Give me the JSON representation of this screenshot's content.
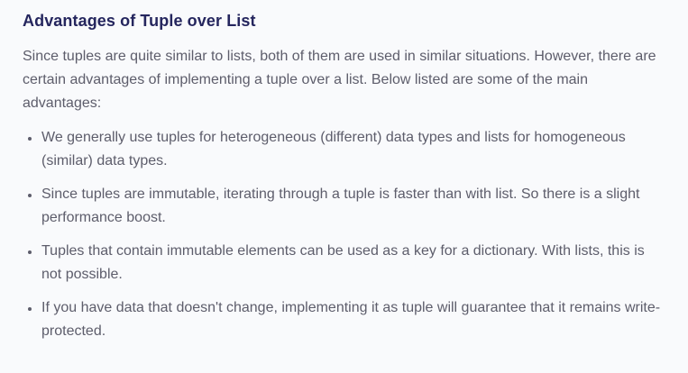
{
  "article": {
    "heading": "Advantages of Tuple over List",
    "intro": "Since tuples are quite similar to lists, both of them are used in similar situations. However, there are certain advantages of implementing a tuple over a list. Below listed are some of the main advantages:",
    "advantages": [
      "We generally use tuples for heterogeneous (different) data types and lists for homogeneous (similar) data types.",
      "Since tuples are immutable, iterating through a tuple is faster than with list. So there is a slight performance boost.",
      "Tuples that contain immutable elements can be used as a key for a dictionary. With lists, this is not possible.",
      "If you have data that doesn't change, implementing it as tuple will guarantee that it remains write-protected."
    ]
  },
  "colors": {
    "heading": "#25265e",
    "body_text": "#5d5d6b",
    "background": "#f9fafc"
  }
}
